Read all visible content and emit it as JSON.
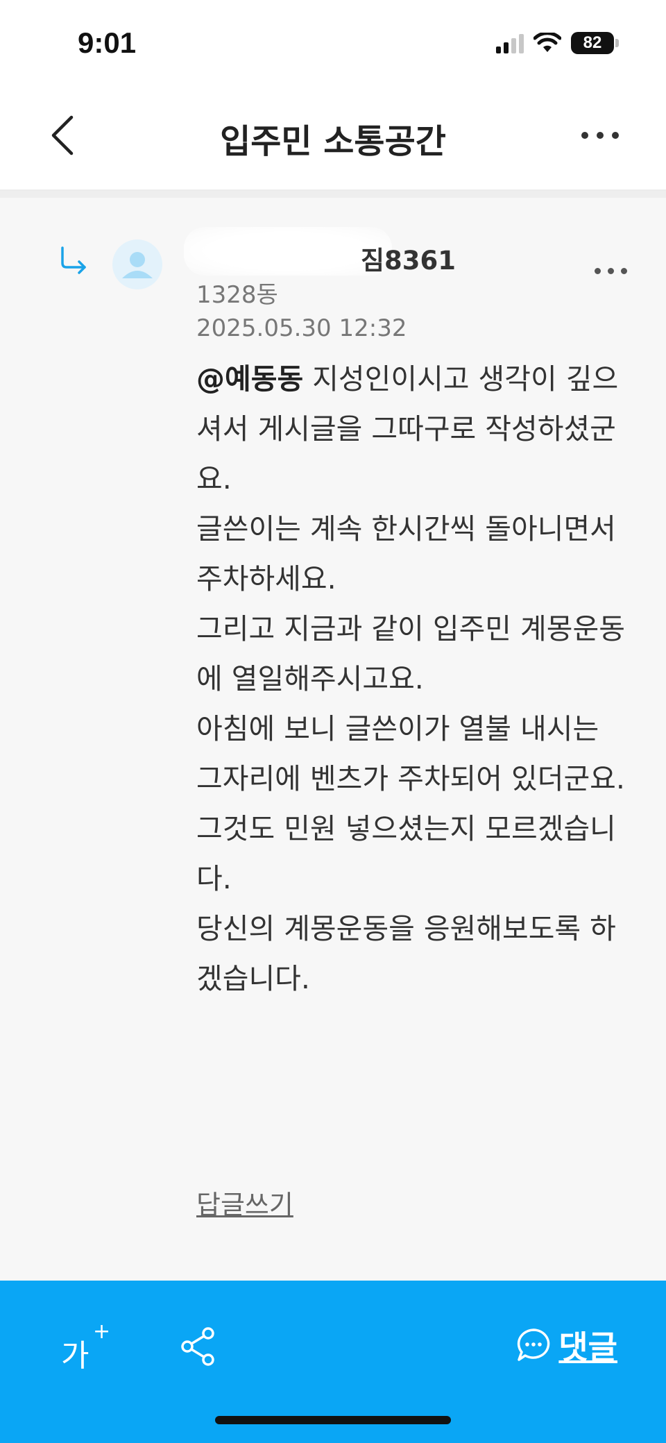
{
  "status_bar": {
    "time": "9:01",
    "battery": "82",
    "icons": [
      "signal-icon",
      "wifi-icon",
      "battery-icon"
    ]
  },
  "header": {
    "title": "입주민 소통공간",
    "back_icon": "chevron-left-icon",
    "more_icon": "more-horizontal-icon"
  },
  "comment": {
    "author_visible": "짐8361",
    "building": "1328동",
    "timestamp": "2025.05.30 12:32",
    "mention": "@예동동",
    "body": " 지성인이시고 생각이 깊으셔서 게시글을 그따구로 작성하셨군요.\n글쓴이는 계속 한시간씩 돌아니면서 주차하세요.\n그리고 지금과 같이 입주민 계몽운동에 열일해주시고요.\n아침에 보니 글쓴이가 열불 내시는 그자리에 벤츠가 주차되어 있더군요.\n그것도 민원 넣으셨는지 모르겠습니다.\n당신의 계몽운동을 응원해보도록 하겠습니다.",
    "reply_link": "답글쓰기"
  },
  "bottom_bar": {
    "font_size_label": "가",
    "font_size_plus": "+",
    "comment_label": "댓글",
    "colors": {
      "background": "#0aa6f5"
    }
  },
  "colors": {
    "accent": "#0aa6f5",
    "reply_arrow": "#1aa3e8"
  }
}
